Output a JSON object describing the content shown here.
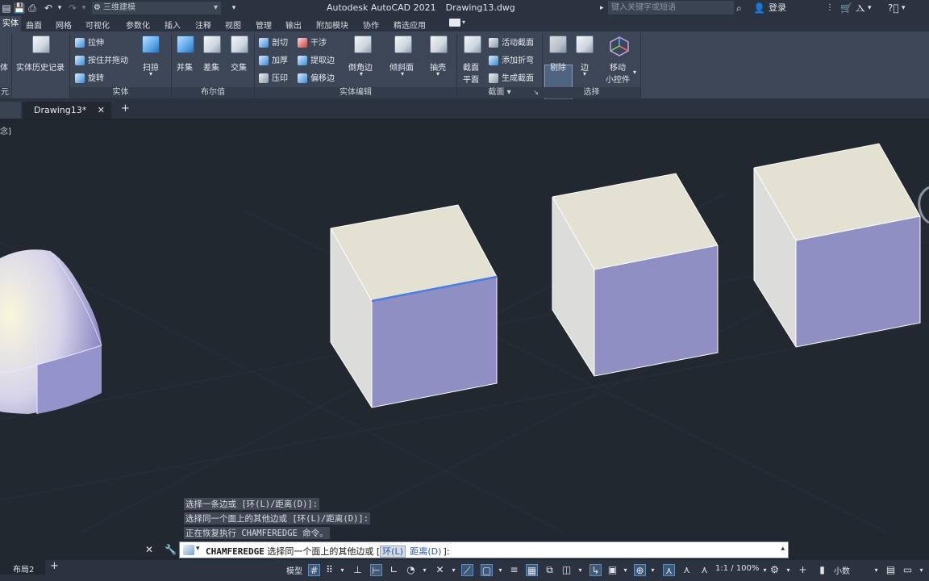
{
  "title": {
    "app": "Autodesk AutoCAD 2021",
    "file": "Drawing13.dwg",
    "workspace": "三维建模",
    "search_placeholder": "键入关键字或短语",
    "login": "登录"
  },
  "ribbon_tabs": [
    "实体",
    "曲面",
    "网格",
    "可视化",
    "参数化",
    "插入",
    "注释",
    "视图",
    "管理",
    "输出",
    "附加模块",
    "协作",
    "精选应用"
  ],
  "ribbon": {
    "entity_left": "体",
    "history": "实体历史记录",
    "pull": "拉伸",
    "presspull": "按住并拖动",
    "revolve": "旋转",
    "sweep": "扫掠",
    "union": "并集",
    "subtract": "差集",
    "intersect": "交集",
    "slice": "剖切",
    "thicken": "加厚",
    "imprint": "压印",
    "interfere": "干涉",
    "extract": "提取边",
    "offset": "偏移边",
    "fillet": "倒角边",
    "taper": "倾斜面",
    "shell": "抽壳",
    "section_plane_1": "截面",
    "section_plane_2": "平面",
    "live_section": "活动截面",
    "add_jog": "添加折弯",
    "generate_section": "生成截面",
    "cull": "剔除",
    "edge": "边",
    "gizmo_1": "移动",
    "gizmo_2": "小控件",
    "panels": {
      "primitive": "元",
      "solid": "实体",
      "boolean": "布尔值",
      "solid_edit": "实体编辑",
      "section": "截面",
      "selection": "选择"
    }
  },
  "file_tab": {
    "name": "Drawing13*"
  },
  "viewport_label": "念]",
  "history": [
    "选择一条边或 [环(L)/距离(D)]:",
    "选择同一个面上的其他边或 [环(L)/距离(D)]:",
    "正在恢复执行 CHAMFEREDGE 命令。"
  ],
  "command": {
    "name": "CHAMFEREDGE",
    "prompt": "选择同一个面上的其他边或 [",
    "opt1": "环(L)",
    "opt2": "距离(D)",
    "tail": "]:"
  },
  "status": {
    "layout2": "布局2",
    "model": "模型",
    "scale": "1:1 / 100%",
    "units": "小数"
  },
  "colors": {
    "background": "#212830",
    "cube_top": "#e3e2d2",
    "cube_side": "#dcdcdb",
    "cube_front": "#8f8fc3",
    "selected_edge": "#4a7fe0"
  }
}
